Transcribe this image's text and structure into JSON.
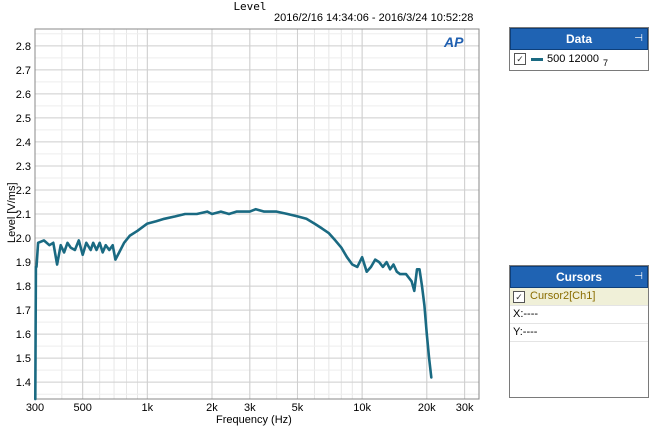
{
  "chart_data": {
    "type": "line",
    "title": "Level",
    "date_range": "2016/2/16 14:34:06 -   2016/3/24 10:52:28",
    "xlabel": "Frequency (Hz)",
    "ylabel": "Level [V/ms]",
    "x_scale": "log",
    "xlim": [
      300,
      35000
    ],
    "ylim": [
      1.33,
      2.87
    ],
    "grid": true,
    "x_ticks": [
      300,
      500,
      1000,
      2000,
      3000,
      5000,
      10000,
      20000,
      30000
    ],
    "x_tick_labels": [
      "300",
      "500",
      "1k",
      "2k",
      "3k",
      "5k",
      "10k",
      "20k",
      "30k"
    ],
    "y_ticks": [
      1.4,
      1.5,
      1.6,
      1.7,
      1.8,
      1.9,
      2.0,
      2.1,
      2.2,
      2.3,
      2.4,
      2.5,
      2.6,
      2.7,
      2.8
    ],
    "y_tick_labels": [
      "1.4",
      "1.5",
      "1.6",
      "1.7",
      "1.8",
      "1.9",
      "2.0",
      "2.1",
      "2.2",
      "2.3",
      "2.4",
      "2.5",
      "2.6",
      "2.7",
      "2.8"
    ],
    "series": [
      {
        "name": "500 12000",
        "color": "#1a6a82",
        "x": [
          301,
          303,
          305,
          310,
          330,
          350,
          365,
          380,
          395,
          410,
          425,
          440,
          460,
          480,
          500,
          520,
          545,
          560,
          580,
          600,
          620,
          640,
          665,
          690,
          710,
          740,
          780,
          830,
          900,
          1000,
          1100,
          1200,
          1350,
          1500,
          1700,
          1900,
          2000,
          2200,
          2400,
          2600,
          2800,
          3000,
          3200,
          3500,
          4000,
          4500,
          5000,
          5500,
          6000,
          6500,
          7000,
          7500,
          8000,
          8500,
          9000,
          9500,
          10000,
          10500,
          11000,
          11500,
          12000,
          12500,
          13000,
          13500,
          14000,
          14500,
          15000,
          16000,
          17000,
          17500,
          18000,
          18500,
          19000,
          19500,
          20000,
          20500,
          21000
        ],
        "y": [
          1.33,
          1.88,
          1.88,
          1.98,
          1.99,
          1.97,
          1.98,
          1.89,
          1.97,
          1.94,
          1.98,
          1.96,
          1.95,
          1.99,
          1.93,
          1.98,
          1.95,
          1.98,
          1.95,
          1.98,
          1.94,
          1.97,
          1.95,
          1.97,
          1.91,
          1.94,
          1.98,
          2.01,
          2.03,
          2.06,
          2.07,
          2.08,
          2.09,
          2.1,
          2.1,
          2.11,
          2.1,
          2.11,
          2.1,
          2.11,
          2.11,
          2.11,
          2.12,
          2.11,
          2.11,
          2.1,
          2.09,
          2.08,
          2.06,
          2.04,
          2.02,
          1.99,
          1.96,
          1.92,
          1.89,
          1.88,
          1.92,
          1.86,
          1.88,
          1.91,
          1.9,
          1.88,
          1.9,
          1.87,
          1.89,
          1.86,
          1.85,
          1.85,
          1.82,
          1.78,
          1.87,
          1.87,
          1.8,
          1.72,
          1.6,
          1.5,
          1.42
        ]
      }
    ]
  },
  "logo_text": "AP",
  "panels": {
    "data": {
      "title": "Data",
      "pin": "⊣",
      "item_checked": "✓",
      "item_label": "500 12000",
      "item_sub": "7"
    },
    "cursors": {
      "title": "Cursors",
      "pin": "⊣",
      "item_checked": "✓",
      "item_label": "Cursor2[Ch1]",
      "x_line": "X:----",
      "y_line": "Y:----"
    }
  }
}
